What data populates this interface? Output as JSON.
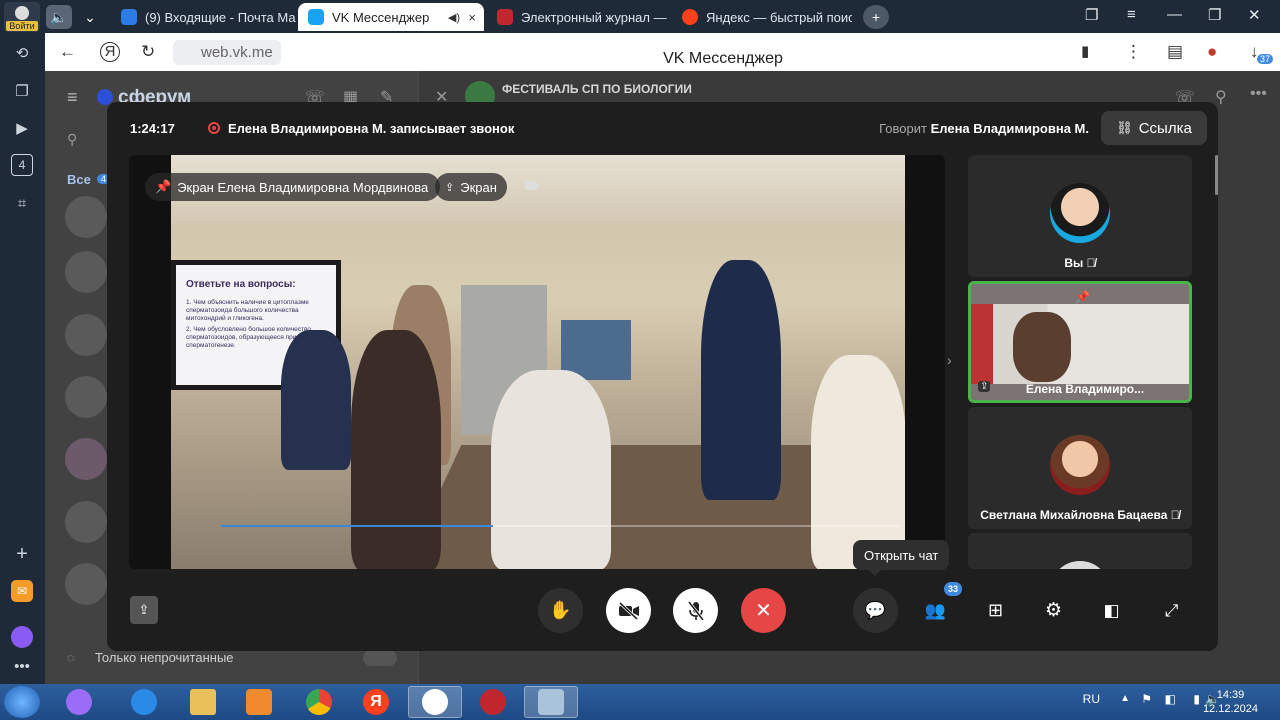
{
  "rail": {
    "login_label": "Войти",
    "badge_count": "4"
  },
  "tabs": [
    {
      "title": "(9) Входящие - Почта Ма",
      "color": "#2d7be5"
    },
    {
      "title": "VK Мессенджер",
      "color": "#1aa3f4",
      "close": "×"
    },
    {
      "title": "Электронный журнал — М",
      "color": "#c1272d"
    },
    {
      "title": "Яндекс — быстрый поиск",
      "color": "#fc3f1d"
    }
  ],
  "address": {
    "url": "web.vk.me",
    "page_title": "VK Мессенджер",
    "downloads_badge": "37"
  },
  "vk": {
    "logo": "сферум",
    "chat_title": "ФЕСТИВАЛЬ СП ПО БИОЛОГИИ",
    "filter_all": "Все",
    "filter_count": "4",
    "unread_only": "Только непрочитанные"
  },
  "call": {
    "timer": "1:24:17",
    "recording_text": "Елена Владимировна М. записывает звонок",
    "speaker_prefix": "Говорит",
    "speaker_name": "Елена Владимировна М.",
    "link_button": "Ссылка",
    "share_label": "Экран Елена Владимировна Мордвинова",
    "screen_chip": "Экран",
    "video_progress": 0.4,
    "slide": {
      "title": "Ответьте на вопросы:",
      "q1": "1. Чем объяснить наличие в цитоплазме сперматозоида большого количества митохондрий и гликогена.",
      "q2": "2. Чем обусловлено большое количество сперматозоидов, образующееся при сперматогенезе."
    },
    "participants": [
      {
        "name": "Вы"
      },
      {
        "name": "Елена Владимиро..."
      },
      {
        "name": "Светлана Михайловна Бацаева"
      }
    ],
    "participants_count": "33",
    "tooltip": "Открыть чат"
  },
  "taskbar": {
    "lang": "RU",
    "time": "14:39",
    "date": "12.12.2024"
  }
}
